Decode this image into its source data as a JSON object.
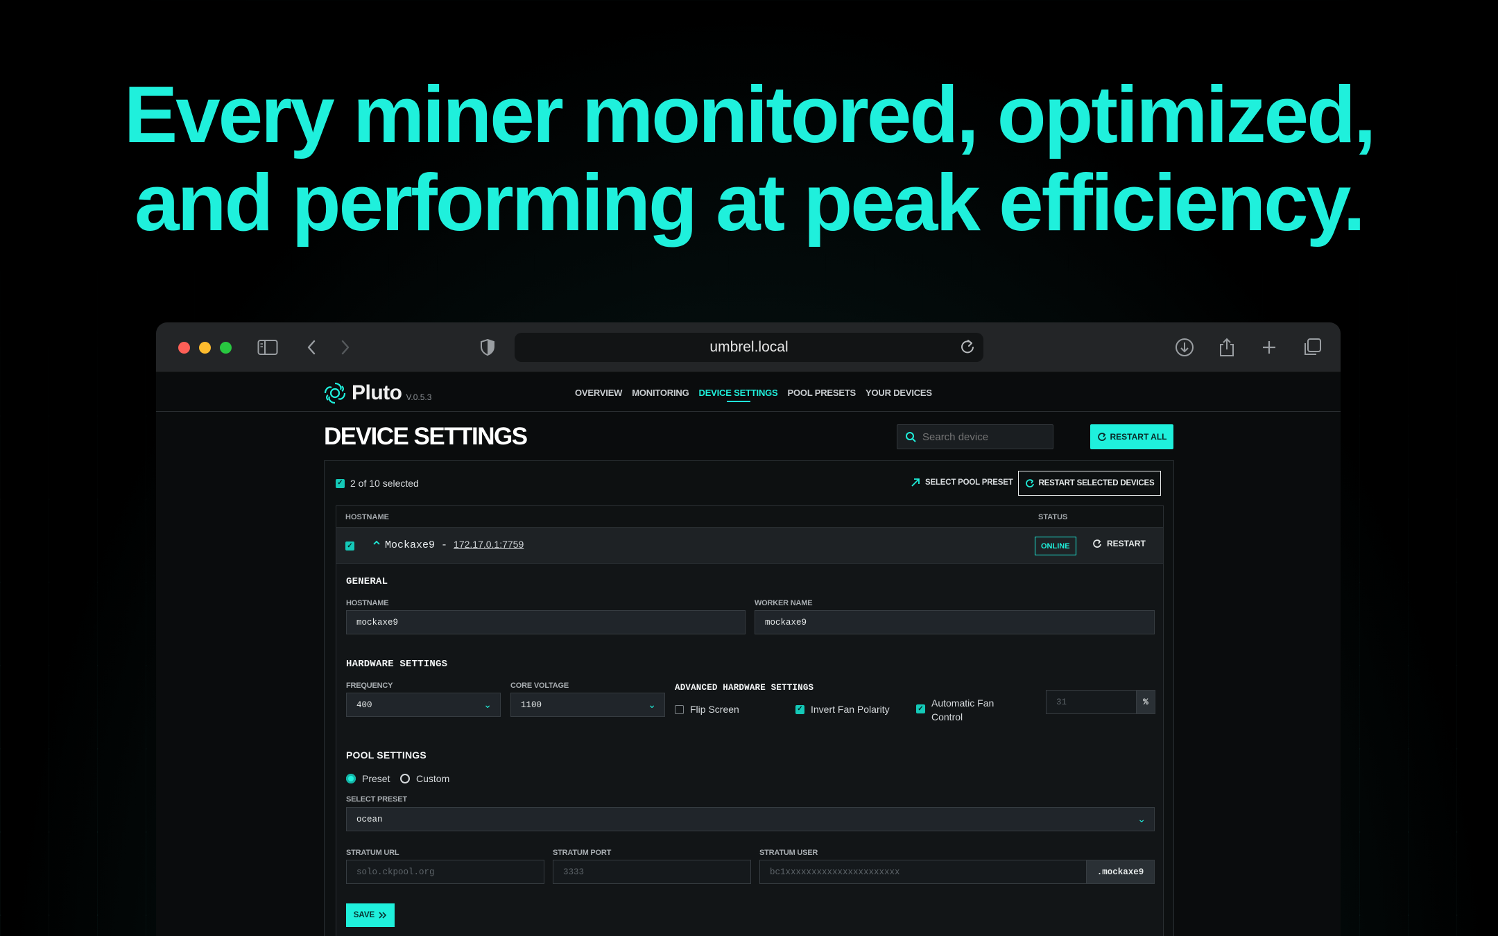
{
  "headline": {
    "line1": "Every miner monitored, optimized,",
    "line2": "and performing at peak efficiency."
  },
  "browser": {
    "url": "umbrel.local",
    "traffic_colors": [
      "#fe5f57",
      "#febc2e",
      "#28c840"
    ]
  },
  "app": {
    "name": "Pluto",
    "version": "V.0.5.3",
    "nav": [
      "OVERVIEW",
      "MONITORING",
      "DEVICE SETTINGS",
      "POOL PRESETS",
      "YOUR DEVICES"
    ],
    "active_nav": "DEVICE SETTINGS",
    "accent": "#1ff0dc"
  },
  "page": {
    "title": "DEVICE SETTINGS",
    "search_placeholder": "Search device",
    "restart_all": "RESTART ALL",
    "selected_text": "2 of 10 selected",
    "select_pool_preset": "SELECT POOL PRESET",
    "restart_selected": "RESTART SELECTED DEVICES"
  },
  "table": {
    "col_hostname": "HOSTNAME",
    "col_status": "STATUS",
    "device": {
      "hostname": "Mockaxe9",
      "separator": " - ",
      "ip": "172.17.0.1:7759",
      "status": "ONLINE",
      "restart": "RESTART"
    }
  },
  "form": {
    "general_title": "GENERAL",
    "hostname_label": "HOSTNAME",
    "hostname_value": "mockaxe9",
    "worker_label": "WORKER NAME",
    "worker_value": "mockaxe9",
    "hardware_title": "HARDWARE SETTINGS",
    "frequency_label": "FREQUENCY",
    "frequency_value": "400",
    "voltage_label": "CORE VOLTAGE",
    "voltage_value": "1100",
    "advanced_title": "ADVANCED HARDWARE SETTINGS",
    "flip_screen": "Flip Screen",
    "flip_screen_checked": false,
    "invert_fan": "Invert Fan Polarity",
    "invert_fan_checked": true,
    "auto_fan_line1": "Automatic Fan",
    "auto_fan_line2": "Control",
    "auto_fan_checked": true,
    "fan_value_placeholder": "31",
    "fan_unit": "%",
    "pool_title": "POOL SETTINGS",
    "preset_label": "Preset",
    "custom_label": "Custom",
    "pool_mode": "Preset",
    "select_preset_label": "SELECT PRESET",
    "select_preset_value": "ocean",
    "stratum_url_label": "STRATUM URL",
    "stratum_url_placeholder": "solo.ckpool.org",
    "stratum_port_label": "STRATUM PORT",
    "stratum_port_placeholder": "3333",
    "stratum_user_label": "STRATUM USER",
    "stratum_user_placeholder": "bc1xxxxxxxxxxxxxxxxxxxxxx",
    "stratum_user_suffix": ".mockaxe9",
    "save_label": "SAVE"
  }
}
